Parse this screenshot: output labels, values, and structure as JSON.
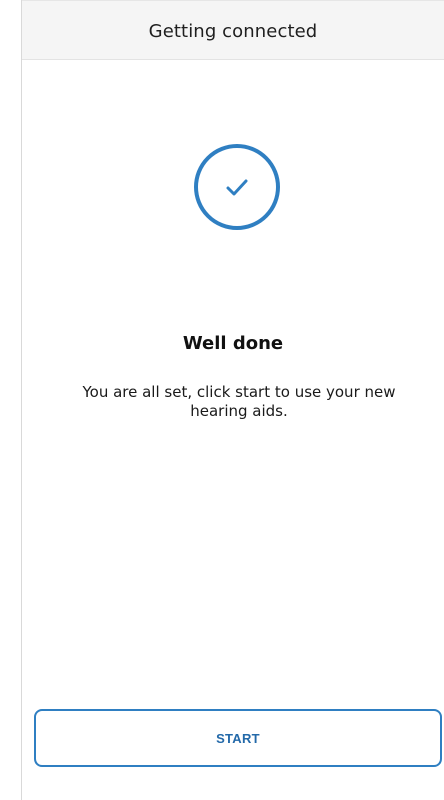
{
  "header": {
    "title": "Getting connected"
  },
  "status": {
    "icon": "check-circle-icon",
    "color": "#2f7fc2"
  },
  "content": {
    "heading": "Well done",
    "message": "You are all set, click start to use your new hearing aids."
  },
  "actions": {
    "start_label": "START"
  }
}
